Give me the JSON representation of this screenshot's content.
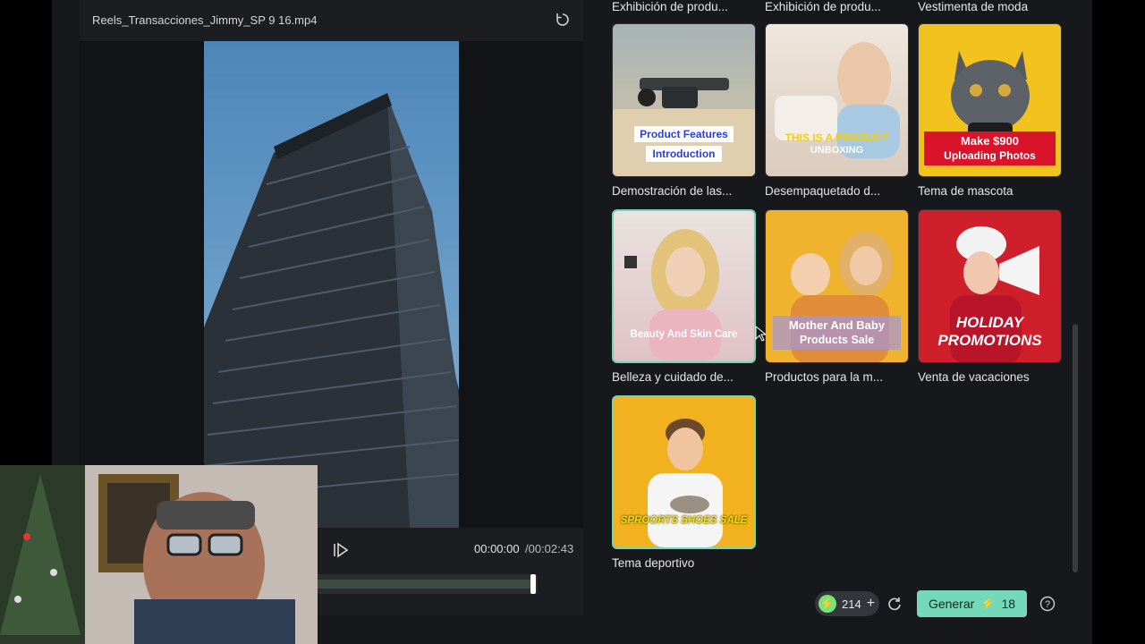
{
  "preview": {
    "file_name": "Reels_Transacciones_Jimmy_SP 9 16.mp4",
    "time_current": "00:00:00",
    "time_total": "/00:02:43"
  },
  "templates": {
    "top_labels": [
      "Exhibición de produ...",
      "Exhibición de produ...",
      "Vestimenta de moda"
    ],
    "cards": [
      {
        "label": "Demostración de las...",
        "overlay": [
          "Product Features",
          "Introduction"
        ]
      },
      {
        "label": "Desempaquetado d...",
        "overlay": [
          "THIS IS A PRODUCT",
          "UNBOXING"
        ]
      },
      {
        "label": "Tema de mascota",
        "overlay": [
          "Make $900",
          "Uploading Photos"
        ]
      },
      {
        "label": "Belleza y cuidado de...",
        "overlay": [
          "Beauty And Skin Care"
        ]
      },
      {
        "label": "Productos para la m...",
        "overlay": [
          "Mother And Baby",
          "Products Sale"
        ]
      },
      {
        "label": "Venta de vacaciones",
        "overlay": [
          "HOLIDAY",
          "PROMOTIONS"
        ]
      },
      {
        "label": "Tema deportivo",
        "overlay": [
          "SPROORTS SHOES SALE"
        ]
      }
    ]
  },
  "footer": {
    "credits": "214",
    "generate_label": "Generar",
    "generate_cost": "18"
  },
  "colors": {
    "accent": "#73d9b8",
    "credit_green": "#79e27b",
    "panel_bg": "#17181b"
  },
  "icons": [
    "reset-icon",
    "play-icon",
    "bolt-icon",
    "plus-icon",
    "refresh-icon",
    "help-icon",
    "cursor-icon"
  ]
}
